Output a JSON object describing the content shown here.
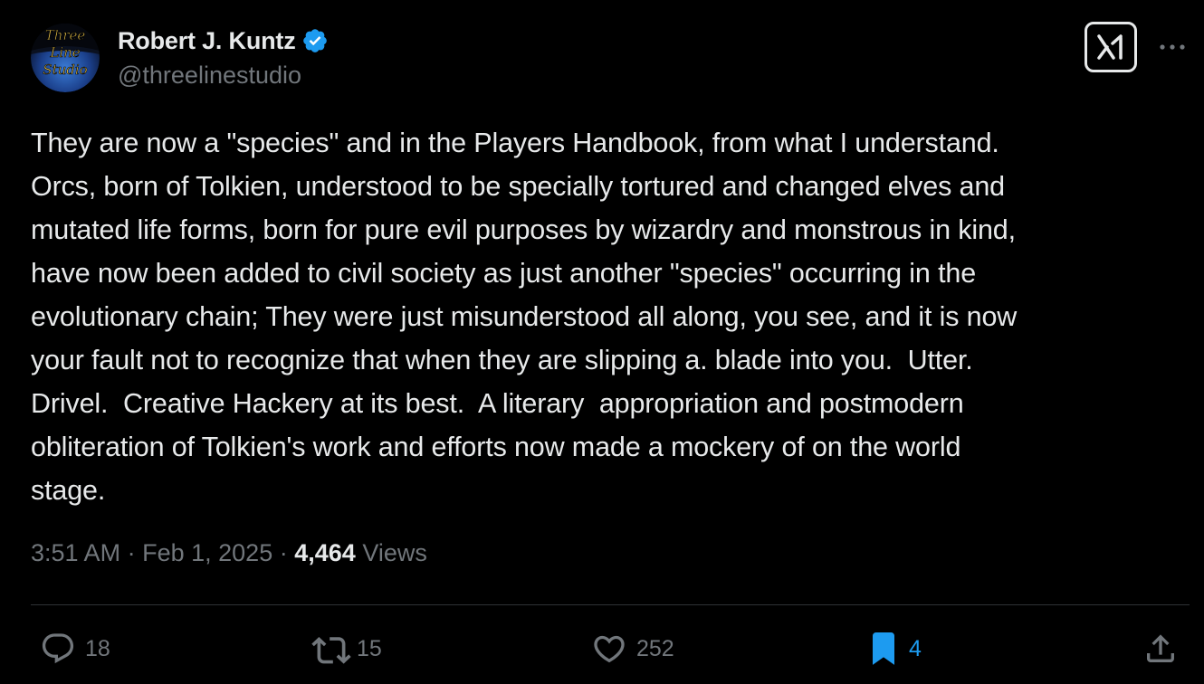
{
  "author": {
    "display_name": "Robert J. Kuntz",
    "handle": "@threelinestudio",
    "verified": true,
    "avatar_lines": [
      "Three",
      "Line",
      "Studio"
    ]
  },
  "tweet": {
    "text": "They are now a \"species\" and in the Players Handbook, from what I understand.\nOrcs, born of Tolkien, understood to be specially tortured and changed elves and\nmutated life forms, born for pure evil purposes by wizardry and monstrous in kind,\nhave now been added to civil society as just another \"species\" occurring in the\nevolutionary chain; They were just misunderstood all along, you see, and it is now\nyour fault not to recognize that when they are slipping a. blade into you.  Utter.\nDrivel.  Creative Hackery at its best.  A literary  appropriation and postmodern\nobliteration of Tolkien's work and efforts now made a mockery of on the world\nstage.",
    "time": "3:51 AM",
    "date": "Feb 1, 2025",
    "separator": "·",
    "views_count": "4,464",
    "views_label": "Views"
  },
  "actions": {
    "replies": "18",
    "reposts": "15",
    "likes": "252",
    "bookmarks": "4"
  },
  "icons": {
    "verified": "verified-badge-icon",
    "grok": "grok-icon",
    "more": "more-dots-icon",
    "reply": "reply-bubble-icon",
    "repost": "repost-arrows-icon",
    "like": "heart-icon",
    "bookmark": "bookmark-icon",
    "share": "share-upload-icon"
  },
  "colors": {
    "background": "#000000",
    "text_primary": "#e7e9ea",
    "text_secondary": "#71767b",
    "accent": "#1d9bf0",
    "divider": "#2f3336"
  }
}
